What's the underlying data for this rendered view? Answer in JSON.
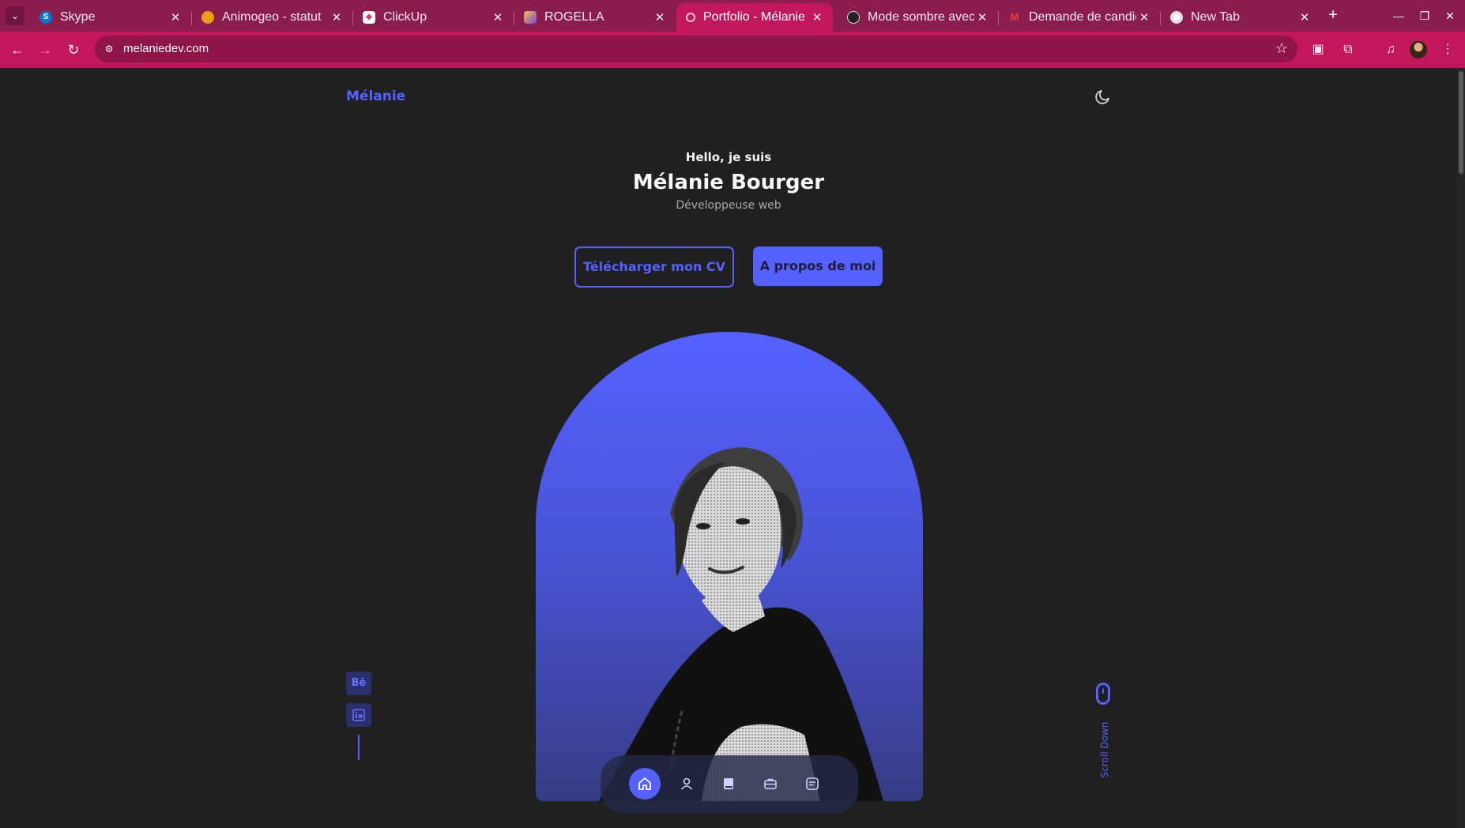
{
  "browser": {
    "tabs": [
      {
        "title": "Skype",
        "favicon": "skype-icon",
        "color": "#0078d4",
        "active": false
      },
      {
        "title": "Animogeo - statut",
        "favicon": "animogeo-icon",
        "color": "#e8a21a",
        "active": false
      },
      {
        "title": "ClickUp",
        "favicon": "clickup-icon",
        "color": "#ffffff",
        "active": false
      },
      {
        "title": "ROGELLA",
        "favicon": "rogella-icon",
        "color": "#7b3fe4",
        "active": false
      },
      {
        "title": "Portfolio - Mélanie",
        "favicon": "portfolio-icon",
        "color": "#c2185b",
        "active": true
      },
      {
        "title": "Mode sombre avec",
        "favicon": "openai-icon",
        "color": "#222222",
        "active": false
      },
      {
        "title": "Demande de candid",
        "favicon": "gmail-icon",
        "color": "#ea4335",
        "active": false
      },
      {
        "title": "New Tab",
        "favicon": "chrome-icon",
        "color": "#ffffff",
        "active": false
      }
    ],
    "url": "melaniedev.com"
  },
  "header": {
    "logo": "Mélanie",
    "theme_toggle_icon": "moon-icon"
  },
  "hero": {
    "greeting": "Hello, je suis",
    "name": "Mélanie Bourger",
    "role": "Développeuse web",
    "cv_button": "Télécharger mon CV",
    "about_button": "A propos de moi",
    "accent_color": "#5561ff"
  },
  "socials": [
    {
      "label": "Bē",
      "icon": "behance-icon"
    },
    {
      "label": "",
      "icon": "linkedin-icon"
    }
  ],
  "scroll": {
    "label": "Scroll Down",
    "icon": "mouse-icon"
  },
  "bottom_nav": [
    {
      "icon": "home-icon",
      "active": true
    },
    {
      "icon": "user-icon",
      "active": false
    },
    {
      "icon": "book-icon",
      "active": false
    },
    {
      "icon": "briefcase-icon",
      "active": false
    },
    {
      "icon": "message-icon",
      "active": false
    }
  ]
}
